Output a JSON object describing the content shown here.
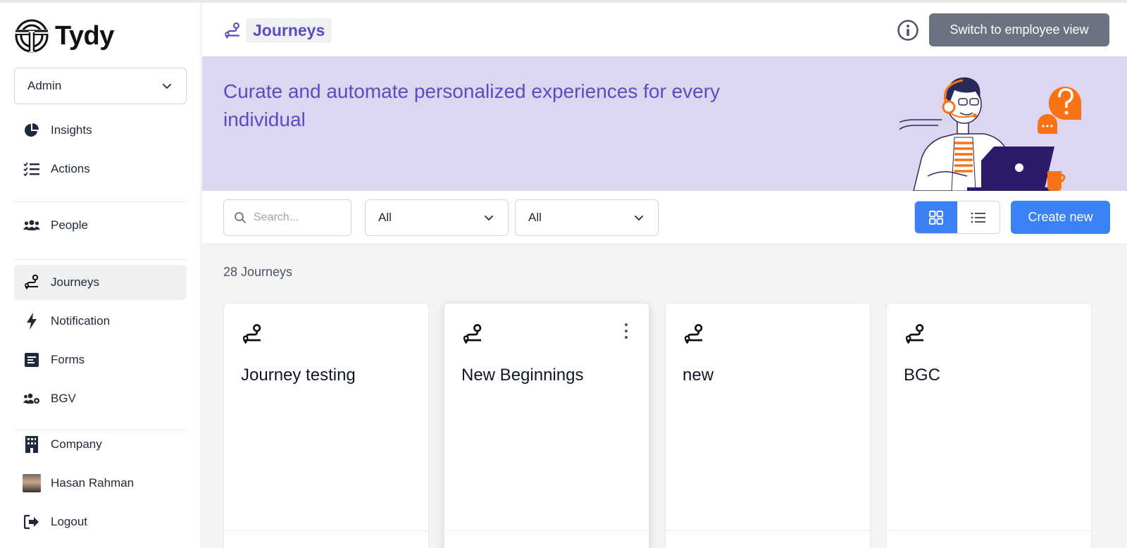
{
  "app": {
    "name": "Tydy"
  },
  "sidebar": {
    "role_select": {
      "value": "Admin"
    },
    "items": [
      {
        "label": "Insights",
        "icon": "pie-chart-icon"
      },
      {
        "label": "Actions",
        "icon": "checklist-icon"
      },
      {
        "label": "People",
        "icon": "users-icon"
      },
      {
        "label": "Journeys",
        "icon": "route-icon",
        "active": true
      },
      {
        "label": "Notification",
        "icon": "bolt-icon"
      },
      {
        "label": "Forms",
        "icon": "form-icon"
      },
      {
        "label": "BGV",
        "icon": "users-gear-icon"
      },
      {
        "label": "Company",
        "icon": "building-icon"
      },
      {
        "label": "Hasan Rahman",
        "icon": "avatar"
      },
      {
        "label": "Logout",
        "icon": "logout-icon"
      }
    ]
  },
  "header": {
    "title": "Journeys",
    "switch_label": "Switch to employee view"
  },
  "banner": {
    "text": "Curate and automate personalized experiences for every individual"
  },
  "toolbar": {
    "search": {
      "placeholder": "Search...",
      "value": ""
    },
    "filters": [
      {
        "value": "All"
      },
      {
        "value": "All"
      }
    ],
    "view_mode": "grid",
    "create_label": "Create new"
  },
  "content": {
    "count_label": "28 Journeys",
    "cards": [
      {
        "title": "Journey testing"
      },
      {
        "title": "New Beginnings"
      },
      {
        "title": "new"
      },
      {
        "title": "BGC"
      }
    ]
  },
  "colors": {
    "accent": "#3b82f6",
    "brand_purple": "#5b4cc4",
    "banner_bg": "#dcd6f0",
    "switch_btn": "#6b7280",
    "illustration_orange": "#f97316"
  }
}
